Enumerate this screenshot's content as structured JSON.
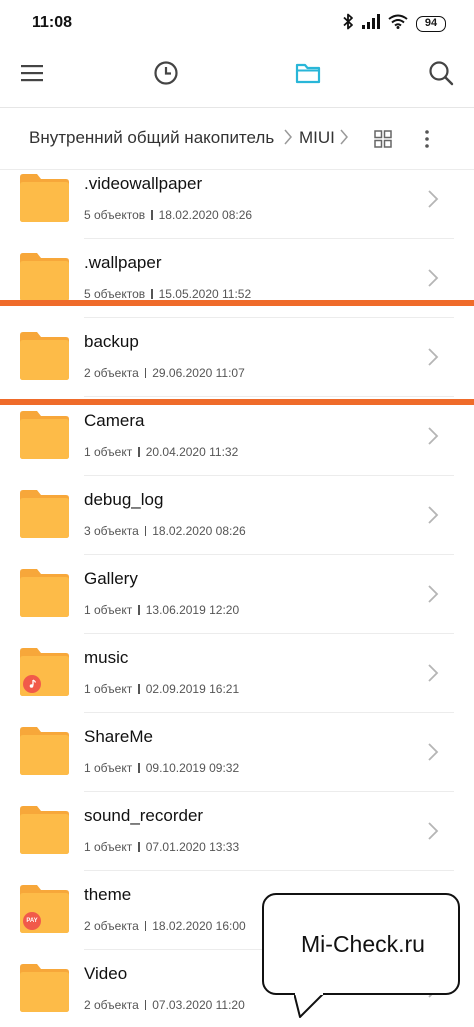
{
  "status_bar": {
    "time": "11:08",
    "battery": "94",
    "icons": [
      "bluetooth-icon",
      "signal-icon",
      "wifi-icon",
      "battery-icon"
    ]
  },
  "toolbar": {
    "icons": [
      "menu-icon",
      "recent-clock-icon",
      "folder-tab-icon",
      "search-icon"
    ],
    "accent": "#29b6d8"
  },
  "path": {
    "root": "Внутренний общий накопитель",
    "folder": "MIUI",
    "icons": [
      "grid-view-icon",
      "more-vert-icon"
    ]
  },
  "colors": {
    "folder": "#fdbb48",
    "folder_tab": "#f7a73a",
    "highlight": "#ef6b2a",
    "badge": "#f15a4a"
  },
  "items": [
    {
      "name": ".videowallpaper",
      "count": "5 объектов",
      "date": "18.02.2020 08:26"
    },
    {
      "name": ".wallpaper",
      "count": "5 объектов",
      "date": "15.05.2020 11:52"
    },
    {
      "name": "backup",
      "count": "2 объекта",
      "date": "29.06.2020 11:07",
      "highlighted": true
    },
    {
      "name": "Camera",
      "count": "1 объект",
      "date": "20.04.2020 11:32"
    },
    {
      "name": "debug_log",
      "count": "3 объекта",
      "date": "18.02.2020 08:26"
    },
    {
      "name": "Gallery",
      "count": "1 объект",
      "date": "13.06.2019 12:20"
    },
    {
      "name": "music",
      "count": "1 объект",
      "date": "02.09.2019 16:21",
      "badge": "music-note-icon"
    },
    {
      "name": "ShareMe",
      "count": "1 объект",
      "date": "09.10.2019 09:32"
    },
    {
      "name": "sound_recorder",
      "count": "1 объект",
      "date": "07.01.2020 13:33"
    },
    {
      "name": "theme",
      "count": "2 объекта",
      "date": "18.02.2020 16:00",
      "badge_text": "PAY"
    },
    {
      "name": "Video",
      "count": "2 объекта",
      "date": "07.03.2020 11:20"
    }
  ],
  "watermark": {
    "text": "Mi-Check.ru"
  }
}
